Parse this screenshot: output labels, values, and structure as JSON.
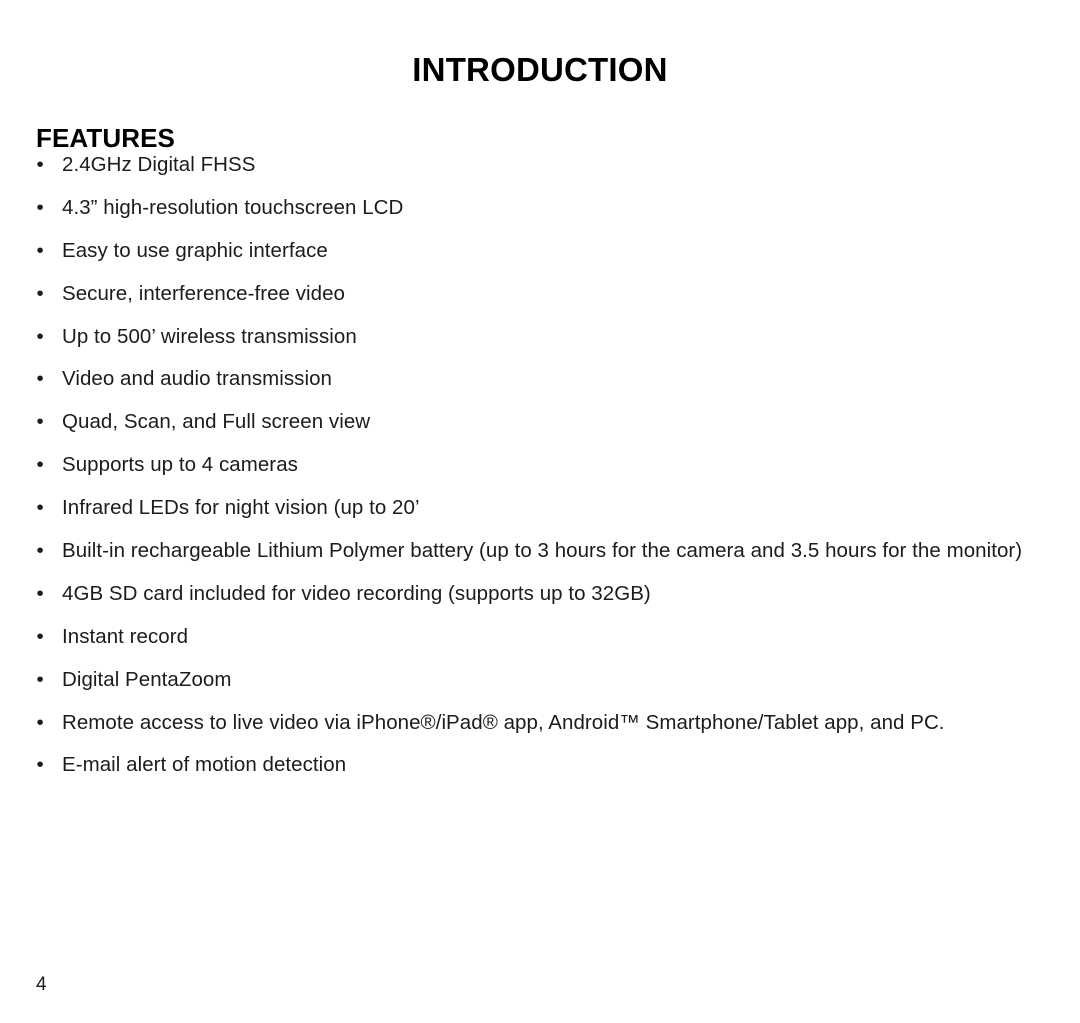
{
  "document": {
    "chapter_title": "INTRODUCTION",
    "section_heading": "FEATURES",
    "page_number": "4"
  },
  "features": [
    {
      "text": "2.4GHz Digital FHSS",
      "bullet": "•"
    },
    {
      "text": "4.3” high-resolution touchscreen LCD",
      "bullet": "•"
    },
    {
      "text": "Easy to use graphic interface",
      "bullet": "•"
    },
    {
      "text": "Secure, interference-free video",
      "bullet": "•"
    },
    {
      "text": "Up to 500’ wireless transmission",
      "bullet": "•"
    },
    {
      "text": "Video and audio transmission",
      "bullet": "•"
    },
    {
      "text": "Quad, Scan, and Full screen view",
      "bullet": "•"
    },
    {
      "text": "Supports up to 4 cameras",
      "bullet": "•"
    },
    {
      "text": "Infrared LEDs for night vision (up to 20’",
      "bullet": "•"
    },
    {
      "text": "Built-in rechargeable Lithium Polymer battery (up to 3 hours for the camera and 3.5 hours for the monitor)",
      "bullet": "•"
    },
    {
      "text": "4GB SD card included for video recording (supports up to 32GB)",
      "bullet": "•"
    },
    {
      "text": "Instant record",
      "bullet": "•"
    },
    {
      "text": "Digital PentaZoom",
      "bullet": "•"
    },
    {
      "text": "Remote access to live video via iPhone®/iPad® app, Android™ Smartphone/Tablet app, and PC.",
      "bullet": "•"
    },
    {
      "text": "E-mail alert of motion detection",
      "bullet": "•"
    }
  ]
}
